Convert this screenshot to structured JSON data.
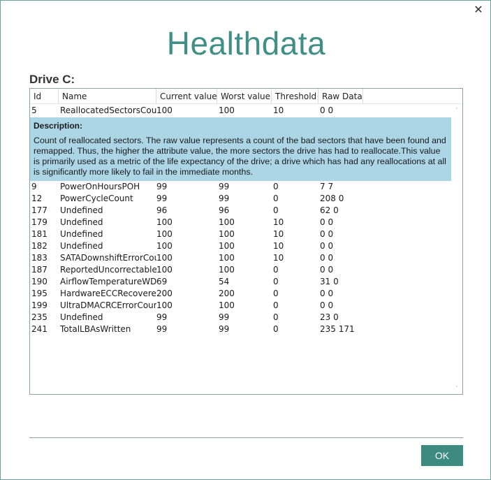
{
  "window": {
    "close_glyph": "✕",
    "close_icon": "close-icon"
  },
  "app_title": "Healthdata",
  "drive_label": "Drive C:",
  "columns": [
    "Id",
    "Name",
    "Current value",
    "Worst value",
    "Threshold",
    "Raw Data"
  ],
  "selected_row": {
    "id": "5",
    "name": "ReallocatedSectorsCount",
    "current": "100",
    "worst": "100",
    "threshold": "10",
    "raw": "0 0"
  },
  "description": {
    "title": "Description:",
    "text": "Count of reallocated sectors. The raw value represents a count of the bad sectors that have been found and remapped. Thus, the higher the attribute value, the more sectors the drive has had to reallocate.This value is primarily used as a metric of the life expectancy of the drive; a drive which has had any reallocations at all is significantly more likely to fail in the immediate months."
  },
  "rows": [
    {
      "id": "9",
      "name": "PowerOnHoursPOH",
      "current": "99",
      "worst": "99",
      "threshold": "0",
      "raw": "7 7"
    },
    {
      "id": "12",
      "name": "PowerCycleCount",
      "current": "99",
      "worst": "99",
      "threshold": "0",
      "raw": "208 0"
    },
    {
      "id": "177",
      "name": "Undefined",
      "current": "96",
      "worst": "96",
      "threshold": "0",
      "raw": "62 0"
    },
    {
      "id": "179",
      "name": "Undefined",
      "current": "100",
      "worst": "100",
      "threshold": "10",
      "raw": "0 0"
    },
    {
      "id": "181",
      "name": "Undefined",
      "current": "100",
      "worst": "100",
      "threshold": "10",
      "raw": "0 0"
    },
    {
      "id": "182",
      "name": "Undefined",
      "current": "100",
      "worst": "100",
      "threshold": "10",
      "raw": "0 0"
    },
    {
      "id": "183",
      "name": "SATADownshiftErrorCount",
      "current": "100",
      "worst": "100",
      "threshold": "10",
      "raw": "0 0"
    },
    {
      "id": "187",
      "name": "ReportedUncorrectableErrors",
      "current": "100",
      "worst": "100",
      "threshold": "0",
      "raw": "0 0"
    },
    {
      "id": "190",
      "name": "AirflowTemperatureWDC",
      "current": "69",
      "worst": "54",
      "threshold": "0",
      "raw": "31 0"
    },
    {
      "id": "195",
      "name": "HardwareECCRecovered",
      "current": "200",
      "worst": "200",
      "threshold": "0",
      "raw": "0 0"
    },
    {
      "id": "199",
      "name": "UltraDMACRCErrorCount",
      "current": "100",
      "worst": "100",
      "threshold": "0",
      "raw": "0 0"
    },
    {
      "id": "235",
      "name": "Undefined",
      "current": "99",
      "worst": "99",
      "threshold": "0",
      "raw": "23 0"
    },
    {
      "id": "241",
      "name": "TotalLBAsWritten",
      "current": "99",
      "worst": "99",
      "threshold": "0",
      "raw": "235 171"
    }
  ],
  "scrollbar": {
    "up_glyph": "˄",
    "down_glyph": "˅"
  },
  "ok_label": "OK",
  "colors": {
    "accent": "#3d8b80",
    "title": "#3f8f86",
    "description_bg": "#acd5e5"
  }
}
